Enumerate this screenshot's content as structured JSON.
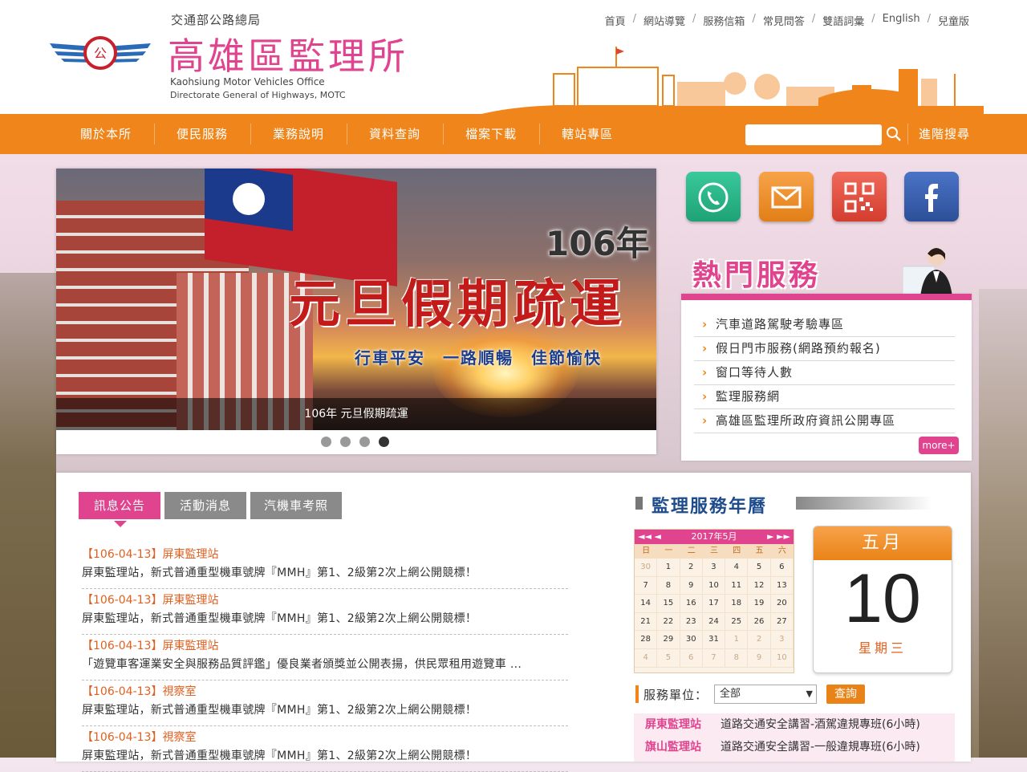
{
  "header": {
    "org": "交通部公路總局",
    "title": "高雄區監理所",
    "en_line1": "Kaohsiung Motor Vehicles Office",
    "en_line2": "Directorate General of Highways, MOTC",
    "top_links": [
      "首頁",
      "網站導覽",
      "服務信箱",
      "常見問答",
      "雙語詞彙",
      "English",
      "兒童版"
    ]
  },
  "nav": {
    "items": [
      "關於本所",
      "便民服務",
      "業務說明",
      "資料查詢",
      "檔案下載",
      "轄站專區"
    ],
    "search_placeholder": "",
    "advanced_search": "進階搜尋"
  },
  "banner": {
    "year": "106年",
    "headline": "元旦假期疏運",
    "slogan": "行車平安　一路順暢　佳節愉快",
    "caption": "106年 元旦假期疏運",
    "slides": 4,
    "active_slide": 4
  },
  "hot": {
    "title": "熱門服務",
    "items": [
      "汽車道路駕駛考驗專區",
      "假日門市服務(網路預約報名)",
      "窗口等待人數",
      "監理服務網",
      "高雄區監理所政府資訊公開專區"
    ],
    "more": "more+"
  },
  "news": {
    "tabs": [
      "訊息公告",
      "活動消息",
      "汽機車考照"
    ],
    "items": [
      {
        "head": "【106-04-13】屏東監理站",
        "body": "屏東監理站，新式普通重型機車號牌『MMH』第1、2級第2次上網公開競標！"
      },
      {
        "head": "【106-04-13】屏東監理站",
        "body": "屏東監理站，新式普通重型機車號牌『MMH』第1、2級第2次上網公開競標！"
      },
      {
        "head": "【106-04-13】屏東監理站",
        "body": "「遊覽車客運業安全與服務品質評鑑」優良業者頒獎並公開表揚，供民眾租用遊覽車 ..."
      },
      {
        "head": "【106-04-13】視察室",
        "body": "屏東監理站，新式普通重型機車號牌『MMH』第1、2級第2次上網公開競標！"
      },
      {
        "head": "【106-04-13】視察室",
        "body": "屏東監理站，新式普通重型機車號牌『MMH』第1、2級第2次上網公開競標！"
      }
    ]
  },
  "calendar": {
    "title": "監理服務年曆",
    "month_label": "2017年5月",
    "dow": [
      "日",
      "一",
      "二",
      "三",
      "四",
      "五",
      "六"
    ],
    "weeks": [
      [
        "30",
        "1",
        "2",
        "3",
        "4",
        "5",
        "6"
      ],
      [
        "7",
        "8",
        "9",
        "10",
        "11",
        "12",
        "13"
      ],
      [
        "14",
        "15",
        "16",
        "17",
        "18",
        "19",
        "20"
      ],
      [
        "21",
        "22",
        "23",
        "24",
        "25",
        "26",
        "27"
      ],
      [
        "28",
        "29",
        "30",
        "31",
        "1",
        "2",
        "3"
      ],
      [
        "4",
        "5",
        "6",
        "7",
        "8",
        "9",
        "10"
      ]
    ],
    "big_month": "五月",
    "big_day": "10",
    "big_weekday": "星期三"
  },
  "service_unit": {
    "label": "服務單位：",
    "selected": "全部",
    "button": "查詢",
    "rows": [
      {
        "unit": "屏東監理站",
        "text": "道路交通安全講習-酒駕違規專班(6小時)"
      },
      {
        "unit": "旗山監理站",
        "text": "道路交通安全講習-一般違規專班(6小時)"
      }
    ]
  },
  "colors": {
    "accent": "#e0448f",
    "nav": "#f0861b"
  }
}
